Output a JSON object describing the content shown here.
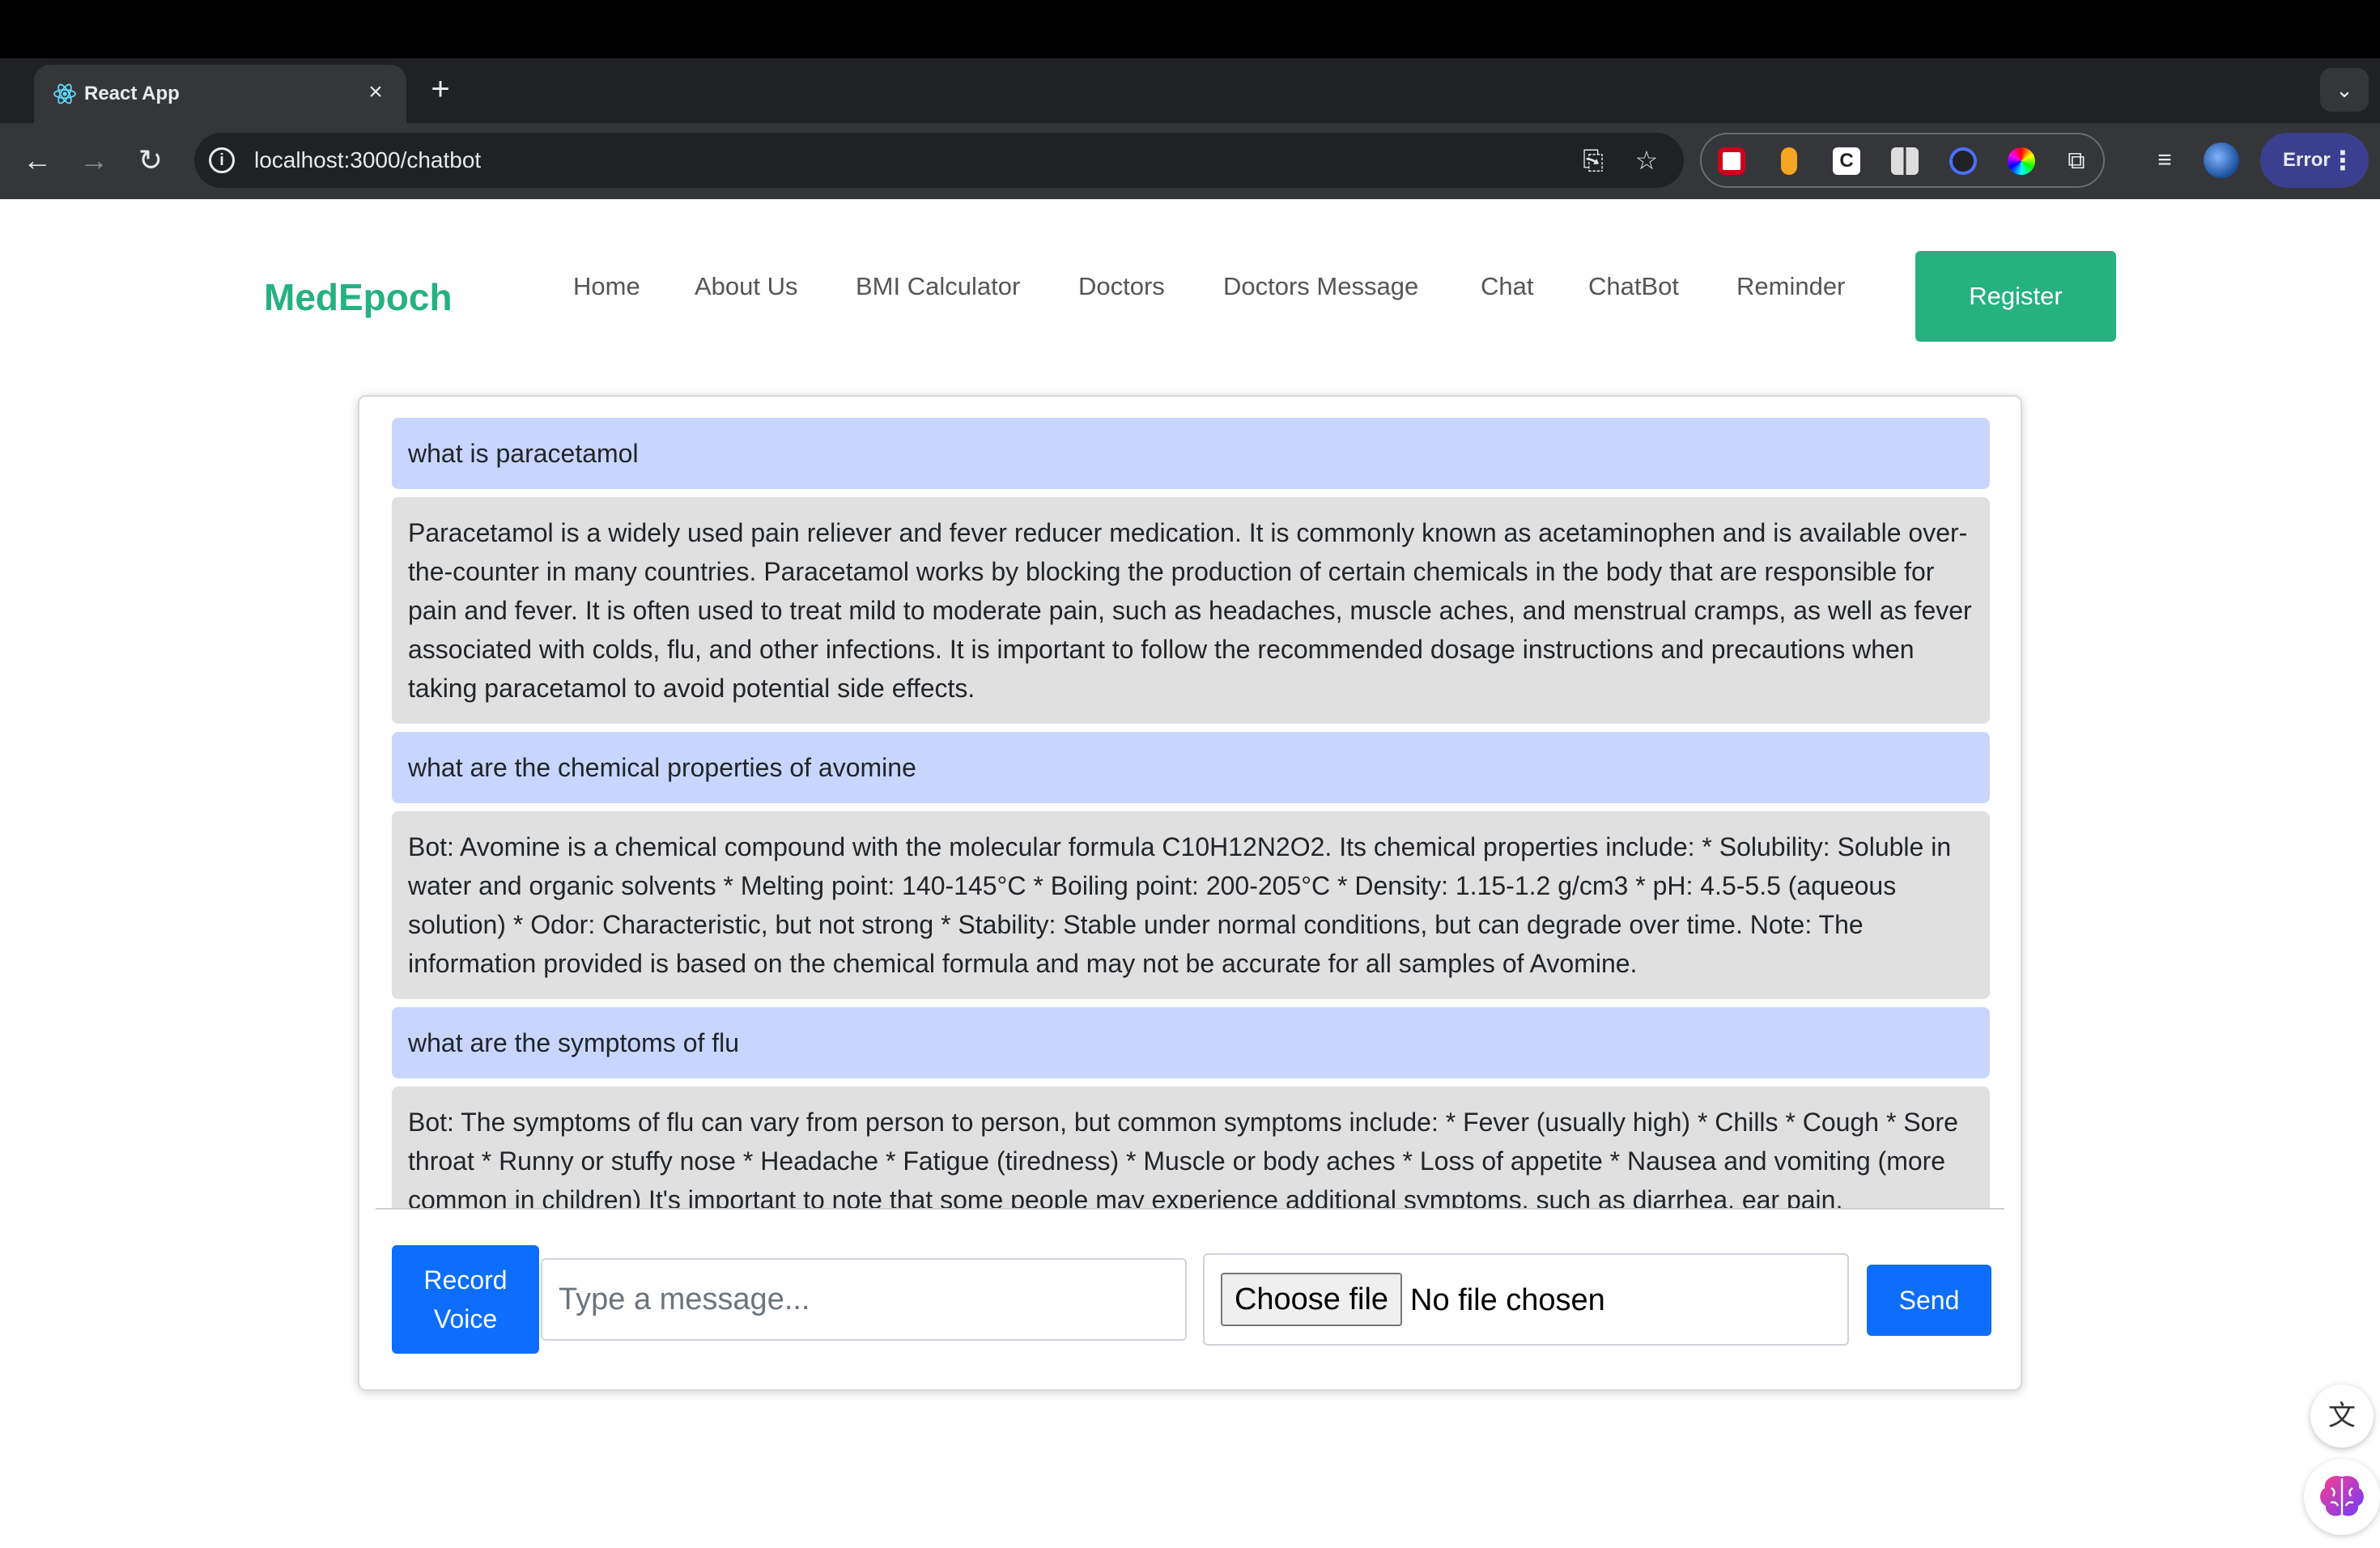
{
  "browser": {
    "tab_title": "React App",
    "close_glyph": "×",
    "new_tab_glyph": "+",
    "url": "localhost:3000/chatbot",
    "profile_status": "Error"
  },
  "icons": {
    "back": "back-arrow-icon",
    "forward": "forward-arrow-icon",
    "reload": "reload-icon",
    "info": "site-info-icon",
    "install": "install-app-icon",
    "bookmark": "star-icon",
    "extensions": "puzzle-icon",
    "media": "media-queue-icon",
    "translate": "translate-icon",
    "brain": "brain-icon"
  },
  "site": {
    "brand": "MedEpoch",
    "nav": [
      "Home",
      "About Us",
      "BMI Calculator",
      "Doctors",
      "Doctors Message",
      "Chat",
      "ChatBot",
      "Reminder"
    ],
    "register_label": "Register"
  },
  "chat": {
    "messages": [
      {
        "role": "user",
        "text": "what is paracetamol"
      },
      {
        "role": "bot",
        "text": "Paracetamol is a widely used pain reliever and fever reducer medication. It is commonly known as acetaminophen and is available over-the-counter in many countries. Paracetamol works by blocking the production of certain chemicals in the body that are responsible for pain and fever. It is often used to treat mild to moderate pain, such as headaches, muscle aches, and menstrual cramps, as well as fever associated with colds, flu, and other infections. It is important to follow the recommended dosage instructions and precautions when taking paracetamol to avoid potential side effects."
      },
      {
        "role": "user",
        "text": "what are the chemical properties of avomine"
      },
      {
        "role": "bot",
        "text": "Bot: Avomine is a chemical compound with the molecular formula C10H12N2O2. Its chemical properties include: * Solubility: Soluble in water and organic solvents * Melting point: 140-145°C * Boiling point: 200-205°C * Density: 1.15-1.2 g/cm3 * pH: 4.5-5.5 (aqueous solution) * Odor: Characteristic, but not strong * Stability: Stable under normal conditions, but can degrade over time. Note: The information provided is based on the chemical formula and may not be accurate for all samples of Avomine."
      },
      {
        "role": "user",
        "text": "what are the symptoms of flu"
      },
      {
        "role": "bot",
        "text": "Bot: The symptoms of flu can vary from person to person, but common symptoms include: * Fever (usually high) * Chills * Cough * Sore throat * Runny or stuffy nose * Headache * Fatigue (tiredness) * Muscle or body aches * Loss of appetite * Nausea and vomiting (more common in children) It's important to note that some people may experience additional symptoms, such as diarrhea, ear pain,"
      }
    ],
    "record_label_line1": "Record",
    "record_label_line2": "Voice",
    "input_placeholder": "Type a message...",
    "choose_file_label": "Choose file",
    "no_file_label": "No file chosen",
    "send_label": "Send"
  },
  "colors": {
    "brand": "#25b180",
    "primary": "#0d6efd",
    "user_bubble": "#c8d6ff",
    "bot_bubble": "#e0e0e0"
  }
}
